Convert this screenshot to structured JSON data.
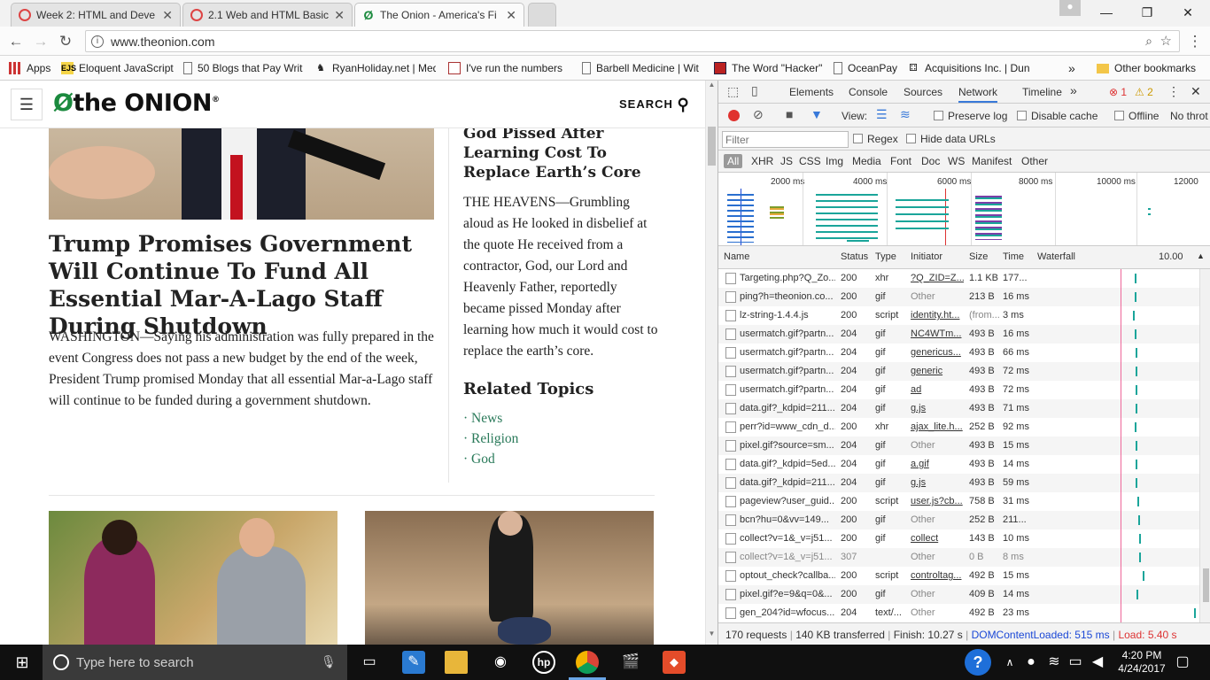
{
  "tabs": [
    {
      "title": "Week 2: HTML and Deve",
      "active": false
    },
    {
      "title": "2.1 Web and HTML Basic",
      "active": false
    },
    {
      "title": "The Onion - America's Fi",
      "active": true
    }
  ],
  "address": {
    "url": "www.theonion.com"
  },
  "bookmarks": {
    "apps": "Apps",
    "items": [
      "Eloquent JavaScript",
      "50 Blogs that Pay Writ",
      "RyanHoliday.net | Med",
      "I've run the numbers",
      "Barbell Medicine | Wit",
      "The Word \"Hacker\"",
      "OceanPay",
      "Acquisitions Inc. | Dun"
    ],
    "overflow": "»",
    "other": "Other bookmarks"
  },
  "site": {
    "logo": "the ONION",
    "logo_mark": "®",
    "search_label": "SEARCH",
    "main_headline": "Trump Promises Government Will Continue To Fund All Essential Mar-A-Lago Staff During Shutdown",
    "main_body": "WASHINGTON—Saying his administration was fully prepared in the event Congress does not pass a new budget by the end of the week, President Trump promised Monday that all essential Mar-a-Lago staff will continue to be funded during a government shutdown.",
    "side_headline": "God Pissed After Learning Cost To Replace Earth’s Core",
    "side_body": "THE HEAVENS—Grumbling aloud as He looked in disbelief at the quote He received from a contractor, God, our Lord and Heavenly Father, reportedly became pissed Monday after learning how much it would cost to replace the earth’s core.",
    "related_title": "Related Topics",
    "topics": [
      "· News",
      "· Religion",
      "· God"
    ]
  },
  "devtools": {
    "tabs": [
      "Elements",
      "Console",
      "Sources",
      "Network",
      "Timeline",
      "»"
    ],
    "selected_tab": "Network",
    "errors": "1",
    "warnings": "2",
    "view_label": "View:",
    "preserve_log": "Preserve log",
    "disable_cache": "Disable cache",
    "offline": "Offline",
    "throttle": "No throt",
    "filter_placeholder": "Filter",
    "regex": "Regex",
    "hide_data": "Hide data URLs",
    "types": [
      "All",
      "XHR",
      "JS",
      "CSS",
      "Img",
      "Media",
      "Font",
      "Doc",
      "WS",
      "Manifest",
      "Other"
    ],
    "timeline_ticks": [
      "2000 ms",
      "4000 ms",
      "6000 ms",
      "8000 ms",
      "10000 ms",
      "12000"
    ],
    "columns": [
      "Name",
      "Status",
      "Type",
      "Initiator",
      "Size",
      "Time",
      "Waterfall"
    ],
    "waterfall_scale": "10.00",
    "rows": [
      {
        "name": "Targeting.php?Q_Zo...",
        "status": "200",
        "type": "xhr",
        "initiator": "?Q_ZID=Z...",
        "size": "1.1 KB",
        "time": "177...",
        "link": true
      },
      {
        "name": "ping?h=theonion.co...",
        "status": "200",
        "type": "gif",
        "initiator": "Other",
        "size": "213 B",
        "time": "16 ms",
        "link": false
      },
      {
        "name": "lz-string-1.4.4.js",
        "status": "200",
        "type": "script",
        "initiator": "identity.ht...",
        "size": "(from...",
        "time": "3 ms",
        "link": true
      },
      {
        "name": "usermatch.gif?partn...",
        "status": "204",
        "type": "gif",
        "initiator": "NC4WTm...",
        "size": "493 B",
        "time": "16 ms",
        "link": true
      },
      {
        "name": "usermatch.gif?partn...",
        "status": "204",
        "type": "gif",
        "initiator": "genericus...",
        "size": "493 B",
        "time": "66 ms",
        "link": true
      },
      {
        "name": "usermatch.gif?partn...",
        "status": "204",
        "type": "gif",
        "initiator": "generic",
        "size": "493 B",
        "time": "72 ms",
        "link": true
      },
      {
        "name": "usermatch.gif?partn...",
        "status": "204",
        "type": "gif",
        "initiator": "ad",
        "size": "493 B",
        "time": "72 ms",
        "link": true
      },
      {
        "name": "data.gif?_kdpid=211...",
        "status": "204",
        "type": "gif",
        "initiator": "g.js",
        "size": "493 B",
        "time": "71 ms",
        "link": true
      },
      {
        "name": "perr?id=www_cdn_d...",
        "status": "200",
        "type": "xhr",
        "initiator": "ajax_lite.h...",
        "size": "252 B",
        "time": "92 ms",
        "link": true
      },
      {
        "name": "pixel.gif?source=sm...",
        "status": "204",
        "type": "gif",
        "initiator": "Other",
        "size": "493 B",
        "time": "15 ms",
        "link": false
      },
      {
        "name": "data.gif?_kdpid=5ed...",
        "status": "204",
        "type": "gif",
        "initiator": "a.gif",
        "size": "493 B",
        "time": "14 ms",
        "link": true
      },
      {
        "name": "data.gif?_kdpid=211...",
        "status": "204",
        "type": "gif",
        "initiator": "g.js",
        "size": "493 B",
        "time": "59 ms",
        "link": true
      },
      {
        "name": "pageview?user_guid...",
        "status": "200",
        "type": "script",
        "initiator": "user.js?cb...",
        "size": "758 B",
        "time": "31 ms",
        "link": true
      },
      {
        "name": "bcn?hu=0&vv=149...",
        "status": "200",
        "type": "gif",
        "initiator": "Other",
        "size": "252 B",
        "time": "211...",
        "link": false
      },
      {
        "name": "collect?v=1&_v=j51...",
        "status": "200",
        "type": "gif",
        "initiator": "collect",
        "size": "143 B",
        "time": "10 ms",
        "link": true
      },
      {
        "name": "collect?v=1&_v=j51...",
        "status": "307",
        "type": "",
        "initiator": "Other",
        "size": "0 B",
        "time": "8 ms",
        "link": false
      },
      {
        "name": "optout_check?callba...",
        "status": "200",
        "type": "script",
        "initiator": "controltag...",
        "size": "492 B",
        "time": "15 ms",
        "link": true
      },
      {
        "name": "pixel.gif?e=9&q=0&...",
        "status": "200",
        "type": "gif",
        "initiator": "Other",
        "size": "409 B",
        "time": "14 ms",
        "link": false
      },
      {
        "name": "gen_204?id=wfocus...",
        "status": "204",
        "type": "text/...",
        "initiator": "Other",
        "size": "492 B",
        "time": "23 ms",
        "link": false
      }
    ],
    "summary": {
      "requests": "170 requests",
      "transferred": "140 KB transferred",
      "finish": "Finish: 10.27 s",
      "dcl": "DOMContentLoaded: 515 ms",
      "load": "Load: 5.40 s"
    }
  },
  "taskbar": {
    "search_placeholder": "Type here to search",
    "time": "4:20 PM",
    "date": "4/24/2017"
  },
  "colors": {
    "onion_green": "#1b8a3e",
    "devtools_blue": "#3879d9",
    "dcl_blue": "#1a47d6",
    "load_red": "#d33"
  }
}
